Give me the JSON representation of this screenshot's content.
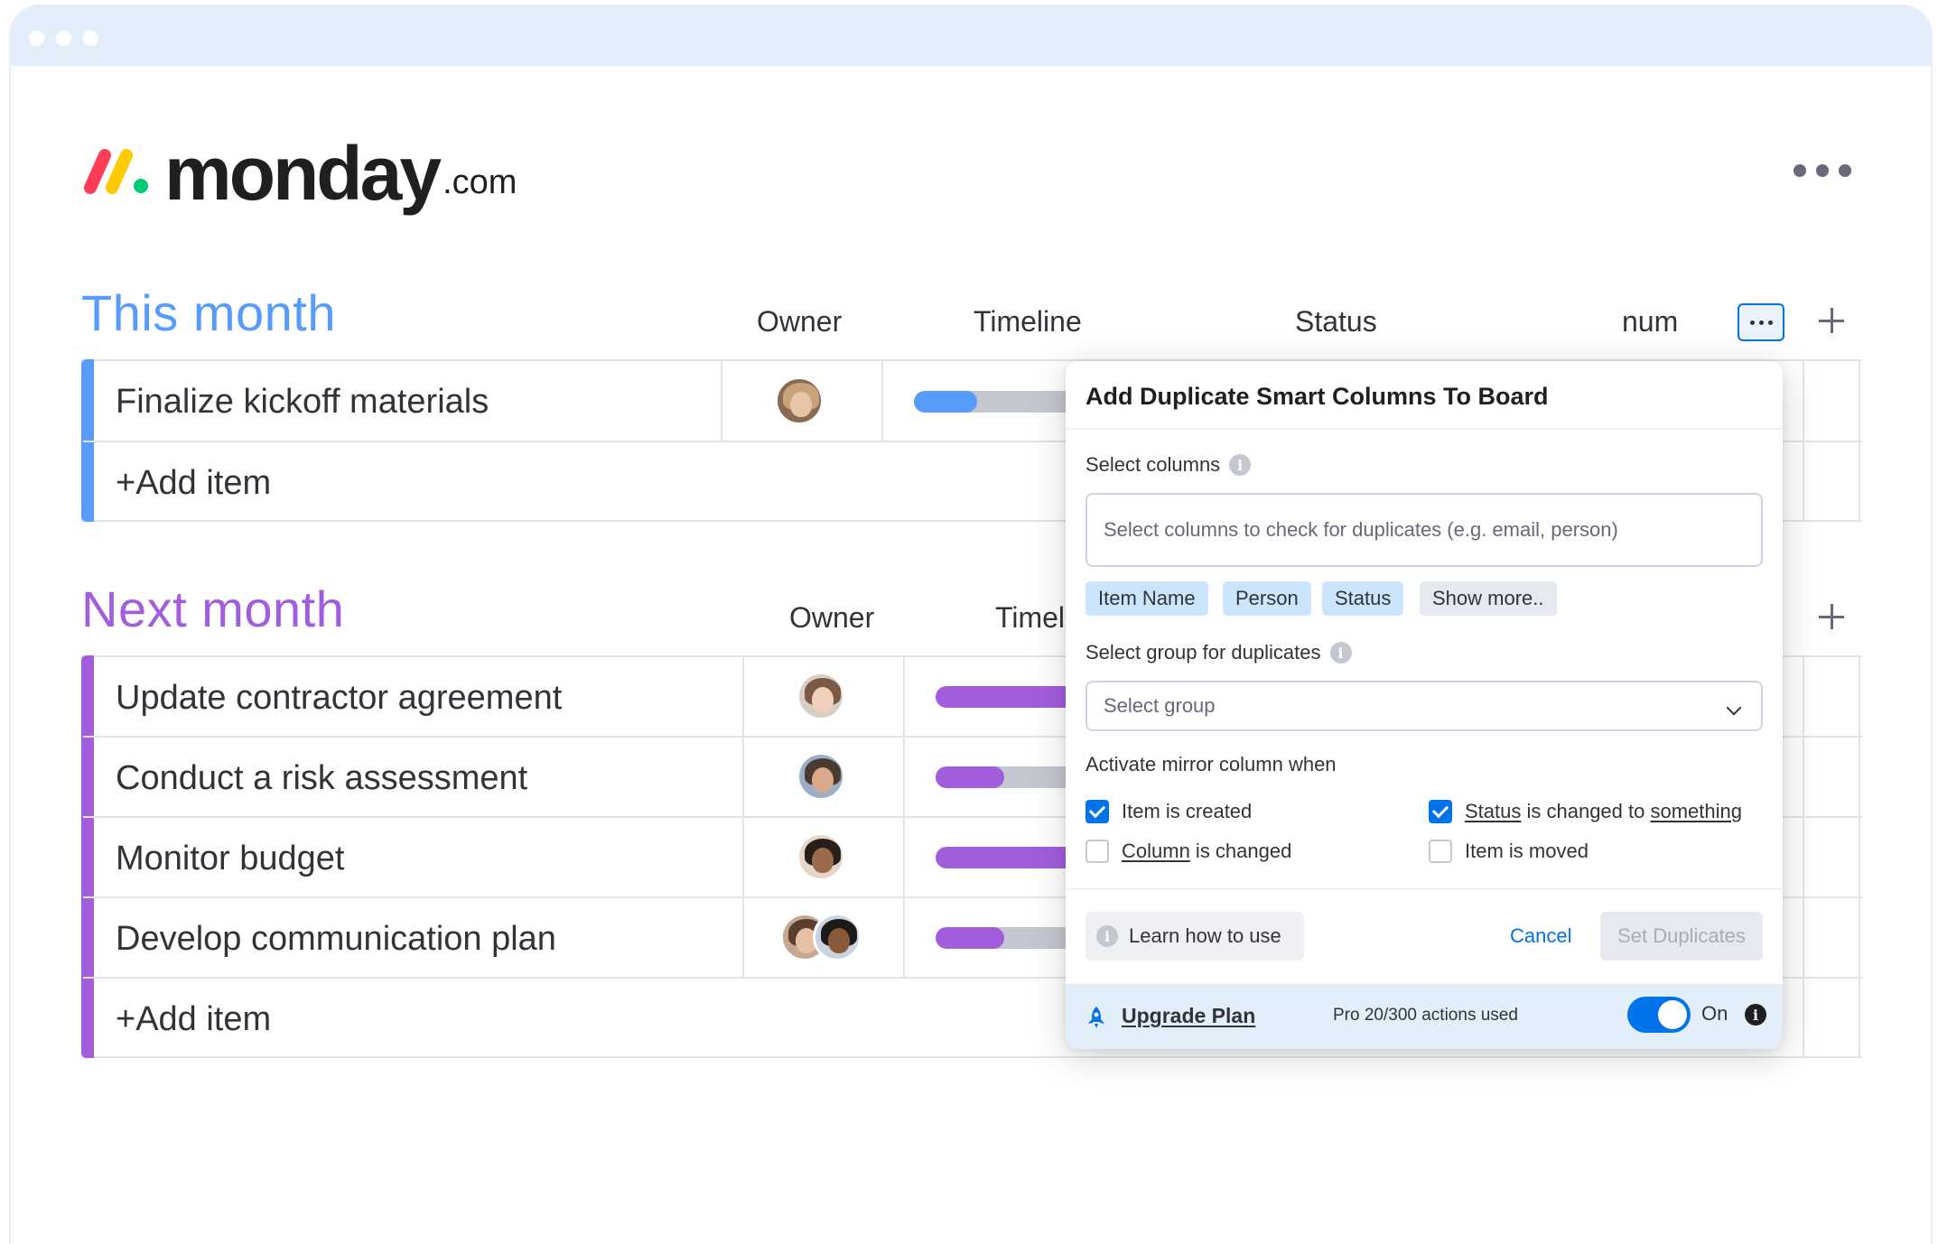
{
  "header": {
    "logo_word": "monday",
    "logo_suffix": ".com"
  },
  "colors": {
    "this_month": "#579bfc",
    "next_month": "#a25ddc",
    "accent": "#0073ea",
    "footer_bg": "#e3eefb"
  },
  "this_month": {
    "title": "This month",
    "columns": [
      "Owner",
      "Timeline",
      "Status",
      "num"
    ],
    "items": [
      {
        "name": "Finalize kickoff materials",
        "timeline_progress": 0.35
      }
    ],
    "add_item": "+Add item"
  },
  "next_month": {
    "title": "Next month",
    "columns": [
      "Owner",
      "Timel"
    ],
    "items": [
      {
        "name": "Update contractor agreement",
        "timeline_progress": 1.0
      },
      {
        "name": "Conduct a risk assessment",
        "timeline_progress": 0.38
      },
      {
        "name": "Monitor budget",
        "timeline_progress": 0.78
      },
      {
        "name": "Develop communication plan",
        "timeline_progress": 0.38
      }
    ],
    "add_item": "+Add item"
  },
  "dialog": {
    "title": "Add Duplicate Smart Columns To Board",
    "select_columns_label": "Select columns",
    "select_columns_placeholder": "Select columns to check for duplicates (e.g. email, person)",
    "chips": [
      "Item Name",
      "Person",
      "Status",
      "Show more.."
    ],
    "select_group_label": "Select group for duplicates",
    "select_group_placeholder": "Select group",
    "activate_label": "Activate mirror column when",
    "triggers": {
      "item_created": {
        "text": "Item is created",
        "checked": true
      },
      "status_changed": {
        "link1": "Status",
        "middle": " is changed to ",
        "link2": "something",
        "checked": true
      },
      "column_changed": {
        "link": "Column",
        "rest": " is changed",
        "checked": false
      },
      "item_moved": {
        "text": "Item is moved",
        "checked": false
      }
    },
    "learn_button": "Learn how to use",
    "cancel_button": "Cancel",
    "set_button": "Set Duplicates",
    "footer": {
      "upgrade": "Upgrade Plan",
      "usage": "Pro 20/300 actions used",
      "toggle_label": "On",
      "toggle_on": true
    }
  }
}
